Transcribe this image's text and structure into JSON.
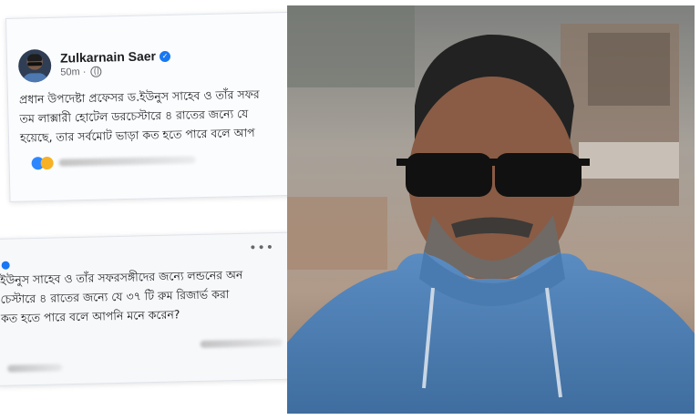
{
  "post1": {
    "author": "Zulkarnain Saer",
    "time": "50m",
    "text_lines": [
      "প্রধান উপদেষ্টা প্রফেসর ড.ইউনুস সাহেব ও তাঁর সফর",
      "তম লাক্সারী হোটেল ডরচেস্টারে ৪ রাতের জন্যে যে",
      "হয়েছে, তার সর্বমোট ভাড়া কত হতে পারে বলে আপ"
    ]
  },
  "post2": {
    "more": "•••",
    "text_lines": [
      "ইউনুস সাহেব ও তাঁর সফরসঙ্গীদের জন্যে লন্ডনের অন",
      "চেস্টারে ৪ রাতের জন্যে যে ৩৭ টি রুম রিজার্ভ করা",
      "কত হতে পারে বলে আপনি মনে করেন?"
    ]
  },
  "colors": {
    "accent": "#1877f2",
    "hoodie": "#4e7fb3",
    "photo_bg": "#a89a8c"
  },
  "icons": [
    "verified-badge-icon",
    "globe-icon",
    "more-options-icon",
    "reaction-like-icon",
    "reaction-haha-icon"
  ]
}
